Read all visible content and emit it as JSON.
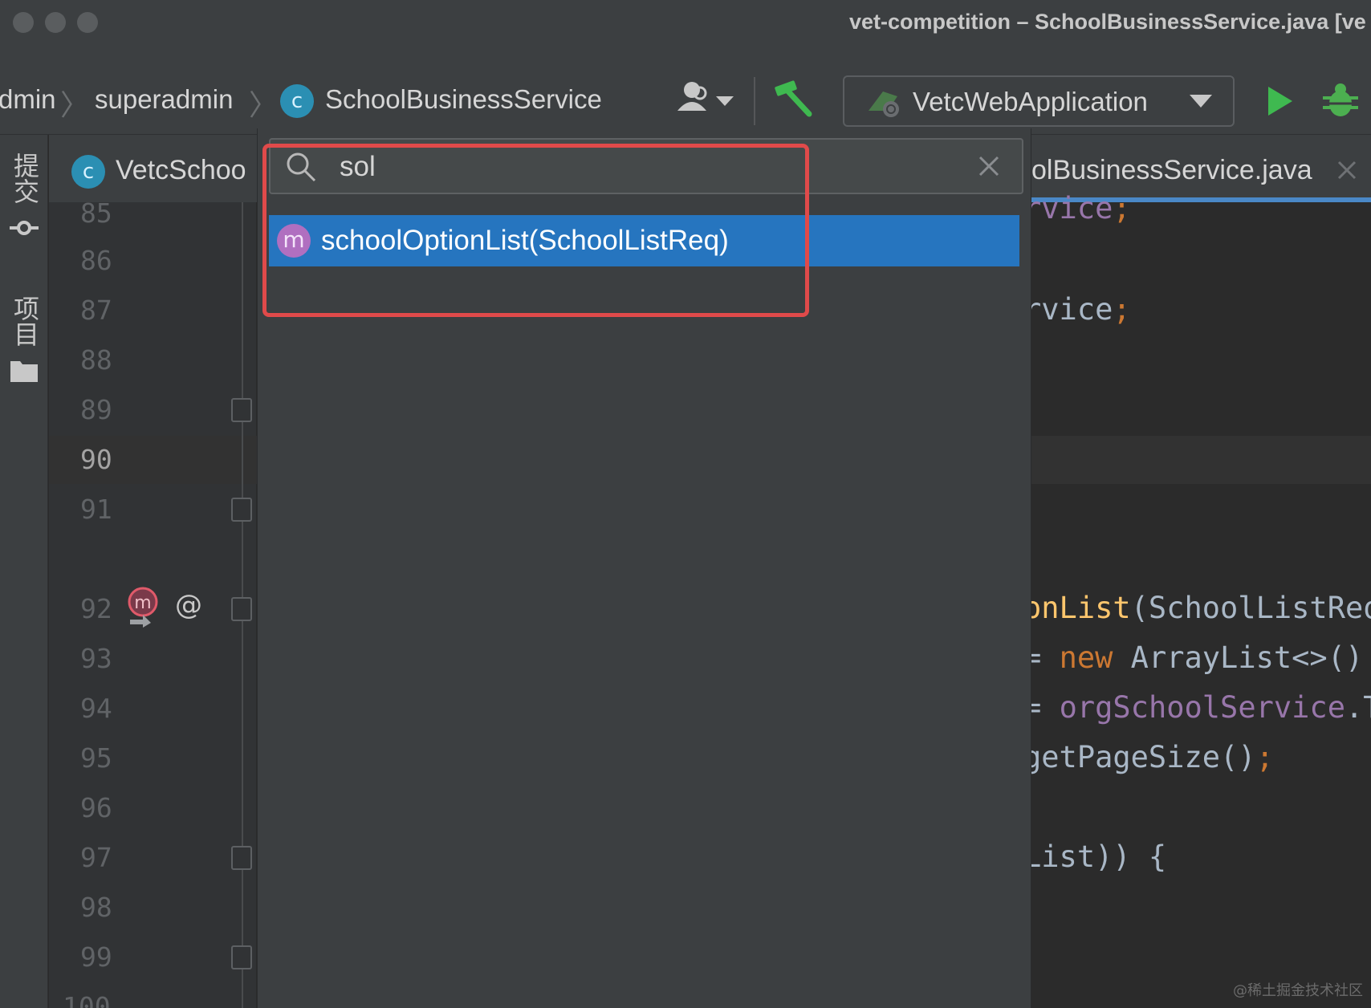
{
  "window": {
    "title": "vet-competition – SchoolBusinessService.java [ve"
  },
  "breadcrumb": {
    "items": [
      "dmin",
      "superadmin",
      "SchoolBusinessService"
    ],
    "class_icon_letter": "c"
  },
  "toolbar": {
    "run_config": "VetcWebApplication"
  },
  "tool_strip": {
    "commit_label": "提交",
    "project_label": "项目"
  },
  "tabs": {
    "left": "VetcSchoo",
    "left_icon_letter": "c",
    "right": "olBusinessService.java"
  },
  "gutter": {
    "line_numbers": [
      "85",
      "86",
      "87",
      "88",
      "89",
      "90",
      "91",
      "92",
      "93",
      "94",
      "95",
      "96",
      "97",
      "98",
      "99",
      "100"
    ],
    "current_line": "90",
    "annotation_symbol": "@"
  },
  "code": {
    "line_85": [
      "rvice",
      ";"
    ],
    "line_87": [
      "rvice",
      ";"
    ],
    "line_92": [
      "onList",
      "(SchoolListReq"
    ],
    "line_93": [
      "= ",
      "new",
      " ArrayList<>()"
    ],
    "line_94": [
      "= ",
      "orgSchoolService",
      ".T"
    ],
    "line_95": [
      "getPageSize()",
      ";"
    ],
    "line_97": [
      "List)) {"
    ]
  },
  "search_popup": {
    "query": "sol",
    "results": [
      {
        "icon_letter": "m",
        "label": "schoolOptionList(SchoolListReq)"
      }
    ]
  },
  "colors": {
    "accent": "#2675bf",
    "highlight": "#e04a4a",
    "run": "#3fb950",
    "debug": "#4caf50"
  },
  "watermark": "@稀土掘金技术社区"
}
